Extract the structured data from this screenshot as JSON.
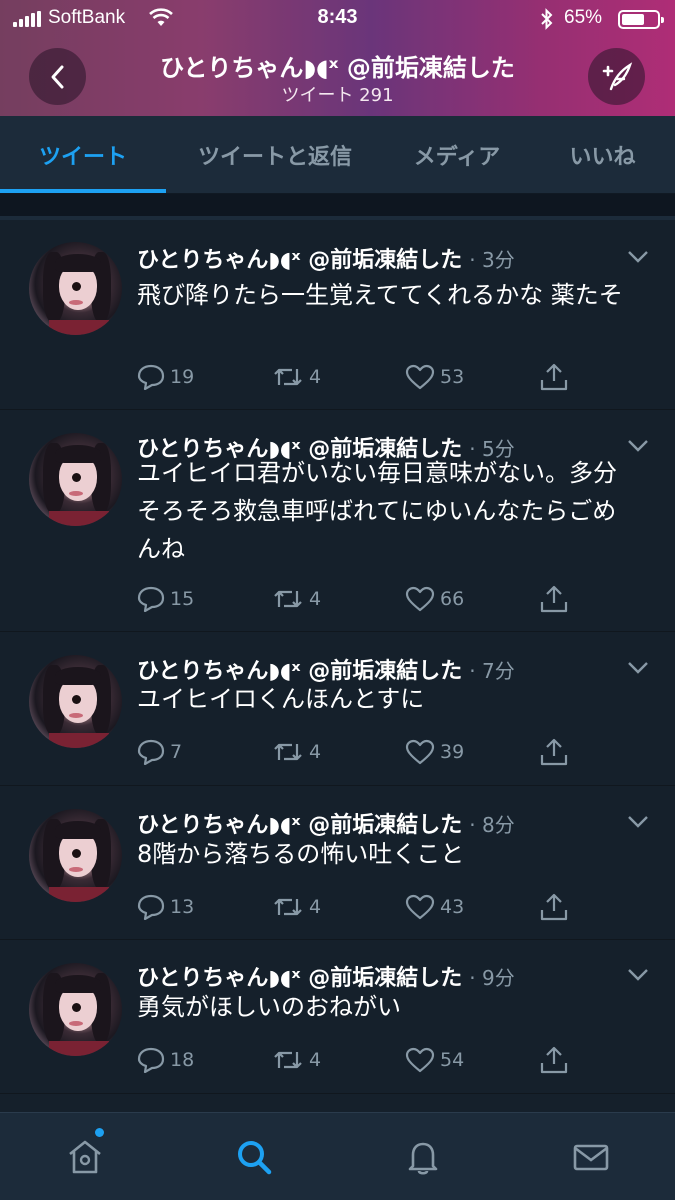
{
  "status_bar": {
    "carrier": "SoftBank",
    "time": "8:43",
    "battery_percent": "65%",
    "battery_level": 0.65
  },
  "profile": {
    "name": "ひとりちゃん◗◖ˣ @前垢凍結した",
    "tweet_count": "ツイート 291"
  },
  "icons": {
    "back": "chevron-left-icon",
    "compose": "compose-tweet-icon",
    "reply": "reply-icon",
    "retweet": "retweet-icon",
    "like": "heart-icon",
    "share": "share-icon",
    "more": "chevron-down-icon"
  },
  "colors": {
    "accent": "#1da1f2",
    "background": "#15202b",
    "muted": "#8899a6"
  },
  "tabs": [
    {
      "label": "ツイート",
      "active": true
    },
    {
      "label": "ツイートと返信",
      "active": false
    },
    {
      "label": "メディア",
      "active": false
    },
    {
      "label": "いいね",
      "active": false
    }
  ],
  "tweets": [
    {
      "name": "ひとりちゃん◗◖ˣ @前垢凍結した",
      "time": "· 3分",
      "text": "飛び降りたら一生覚えててくれるかな 薬たそ",
      "replies": "19",
      "retweets": "4",
      "likes": "53"
    },
    {
      "name": "ひとりちゃん◗◖ˣ @前垢凍結した",
      "time": "· 5分",
      "text": "ユイヒイロ君がいない毎日意味がない。多分そろそろ救急車呼ばれてにゆいんなたらごめんね",
      "replies": "15",
      "retweets": "4",
      "likes": "66"
    },
    {
      "name": "ひとりちゃん◗◖ˣ @前垢凍結した",
      "time": "· 7分",
      "text": "ユイヒイロくんほんとすに",
      "replies": "7",
      "retweets": "4",
      "likes": "39"
    },
    {
      "name": "ひとりちゃん◗◖ˣ @前垢凍結した",
      "time": "· 8分",
      "text": "8階から落ちるの怖い吐くこと",
      "replies": "13",
      "retweets": "4",
      "likes": "43"
    },
    {
      "name": "ひとりちゃん◗◖ˣ @前垢凍結した",
      "time": "· 9分",
      "text": "勇気がほしいのおねがい",
      "replies": "18",
      "retweets": "4",
      "likes": "54"
    }
  ],
  "bottom_nav": [
    {
      "icon": "home-icon",
      "active": false,
      "has_notification_dot": true
    },
    {
      "icon": "search-icon",
      "active": true
    },
    {
      "icon": "bell-icon",
      "active": false
    },
    {
      "icon": "mail-icon",
      "active": false
    }
  ]
}
